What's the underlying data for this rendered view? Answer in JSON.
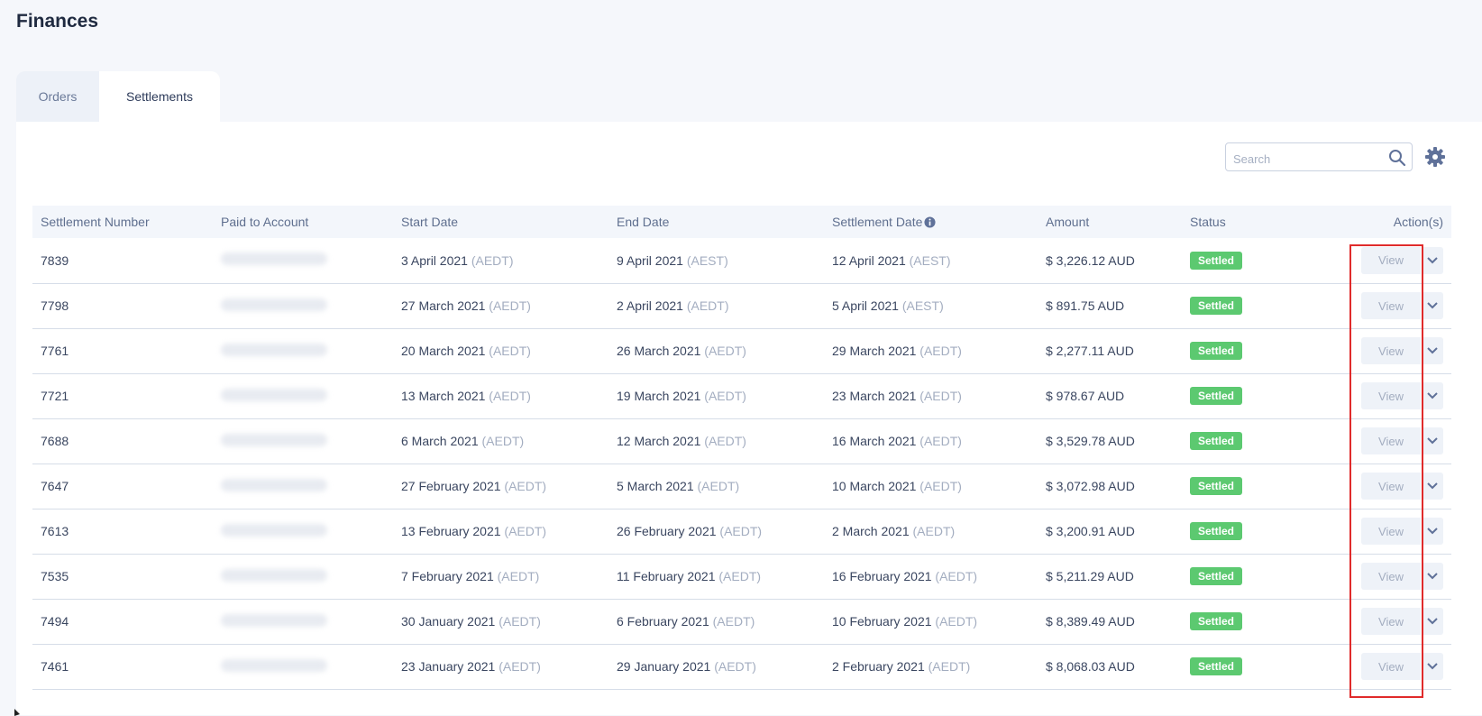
{
  "page_title": "Finances",
  "tabs": [
    {
      "label": "Orders",
      "active": false
    },
    {
      "label": "Settlements",
      "active": true
    }
  ],
  "search": {
    "placeholder": "Search",
    "value": ""
  },
  "columns": {
    "settlement_number": "Settlement Number",
    "paid_to_account": "Paid to Account",
    "start_date": "Start Date",
    "end_date": "End Date",
    "settlement_date": "Settlement Date",
    "amount": "Amount",
    "status": "Status",
    "actions": "Action(s)"
  },
  "rows": [
    {
      "number": "7839",
      "start": "3 April 2021",
      "start_tz": "(AEDT)",
      "end": "9 April 2021",
      "end_tz": "(AEST)",
      "settle": "12 April 2021",
      "settle_tz": "(AEST)",
      "amount": "$ 3,226.12 AUD",
      "status": "Settled",
      "action": "View"
    },
    {
      "number": "7798",
      "start": "27 March 2021",
      "start_tz": "(AEDT)",
      "end": "2 April 2021",
      "end_tz": "(AEDT)",
      "settle": "5 April 2021",
      "settle_tz": "(AEST)",
      "amount": "$ 891.75 AUD",
      "status": "Settled",
      "action": "View"
    },
    {
      "number": "7761",
      "start": "20 March 2021",
      "start_tz": "(AEDT)",
      "end": "26 March 2021",
      "end_tz": "(AEDT)",
      "settle": "29 March 2021",
      "settle_tz": "(AEDT)",
      "amount": "$ 2,277.11 AUD",
      "status": "Settled",
      "action": "View"
    },
    {
      "number": "7721",
      "start": "13 March 2021",
      "start_tz": "(AEDT)",
      "end": "19 March 2021",
      "end_tz": "(AEDT)",
      "settle": "23 March 2021",
      "settle_tz": "(AEDT)",
      "amount": "$ 978.67 AUD",
      "status": "Settled",
      "action": "View"
    },
    {
      "number": "7688",
      "start": "6 March 2021",
      "start_tz": "(AEDT)",
      "end": "12 March 2021",
      "end_tz": "(AEDT)",
      "settle": "16 March 2021",
      "settle_tz": "(AEDT)",
      "amount": "$ 3,529.78 AUD",
      "status": "Settled",
      "action": "View"
    },
    {
      "number": "7647",
      "start": "27 February 2021",
      "start_tz": "(AEDT)",
      "end": "5 March 2021",
      "end_tz": "(AEDT)",
      "settle": "10 March 2021",
      "settle_tz": "(AEDT)",
      "amount": "$ 3,072.98 AUD",
      "status": "Settled",
      "action": "View"
    },
    {
      "number": "7613",
      "start": "13 February 2021",
      "start_tz": "(AEDT)",
      "end": "26 February 2021",
      "end_tz": "(AEDT)",
      "settle": "2 March 2021",
      "settle_tz": "(AEDT)",
      "amount": "$ 3,200.91 AUD",
      "status": "Settled",
      "action": "View"
    },
    {
      "number": "7535",
      "start": "7 February 2021",
      "start_tz": "(AEDT)",
      "end": "11 February 2021",
      "end_tz": "(AEDT)",
      "settle": "16 February 2021",
      "settle_tz": "(AEDT)",
      "amount": "$ 5,211.29 AUD",
      "status": "Settled",
      "action": "View"
    },
    {
      "number": "7494",
      "start": "30 January 2021",
      "start_tz": "(AEDT)",
      "end": "6 February 2021",
      "end_tz": "(AEDT)",
      "settle": "10 February 2021",
      "settle_tz": "(AEDT)",
      "amount": "$ 8,389.49 AUD",
      "status": "Settled",
      "action": "View"
    },
    {
      "number": "7461",
      "start": "23 January 2021",
      "start_tz": "(AEDT)",
      "end": "29 January 2021",
      "end_tz": "(AEDT)",
      "settle": "2 February 2021",
      "settle_tz": "(AEDT)",
      "amount": "$ 8,068.03 AUD",
      "status": "Settled",
      "action": "View"
    }
  ],
  "colors": {
    "settled_badge": "#5cc970",
    "highlight_box": "#e02b2b",
    "accent_icon": "#5f7199"
  },
  "icons": [
    "search-icon",
    "gear-icon",
    "info-icon",
    "chevron-down-icon"
  ]
}
